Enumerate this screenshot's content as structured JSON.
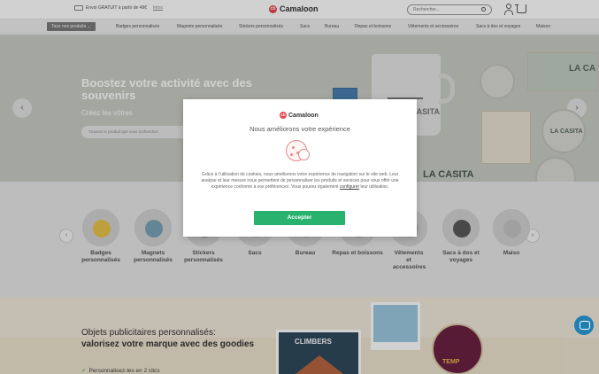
{
  "topbar": {
    "shipping_text": "Envoi GRATUIT à partir de 49€",
    "shipping_more": "Infos",
    "brand": "Camaloon",
    "brand_mark": "cb",
    "search_placeholder": "Rechercher..."
  },
  "catnav": {
    "all_products": "Tous nos produits  ⌄",
    "items": [
      "Badges personnalisés",
      "Magnets personnalisés",
      "Stickers personnalisés",
      "Sacs",
      "Bureau",
      "Repas et boissons",
      "Vêtements et accessoires",
      "Sacs à dos et voyages",
      "Maison"
    ]
  },
  "hero": {
    "title": "Boostez votre activité avec des souvenirs",
    "subtitle": "Créez les vôtres",
    "search_placeholder": "Trouvez le produit que vous recherchez",
    "mug_text": "LA CASITA",
    "sticker_1": "LA CASITA",
    "sticker_2": "LA CASITA",
    "sticker_3": "LA CA",
    "prev_arrow": "‹",
    "next_arrow": "›"
  },
  "categories": [
    {
      "label": "Badges personnalisés",
      "color": "#e9c24a"
    },
    {
      "label": "Magnets personnalisés",
      "color": "#7aa3b8"
    },
    {
      "label": "Stickers personnalisés",
      "color": "#8c9aa6"
    },
    {
      "label": "Sacs",
      "color": "#c9c2b4"
    },
    {
      "label": "Bureau",
      "color": "#b8b8b8"
    },
    {
      "label": "Repas et boissons",
      "color": "#a8a8a8"
    },
    {
      "label": "Vêtements et accessoires",
      "color": "#bdbdbd"
    },
    {
      "label": "Sacs à dos et voyages",
      "color": "#5a5a5a"
    },
    {
      "label": "Maiso",
      "color": "#c4c4c4"
    }
  ],
  "promo": {
    "title_line1": "Objets publicitaires personnalisés:",
    "title_line2": "valorisez votre marque avec des goodies",
    "check_item": "Personnalisez-les en 2 clics",
    "poster_text": "CLIMBERS",
    "badge_text": "TEMP"
  },
  "cookie_modal": {
    "brand": "Camaloon",
    "title": "Nous améliorons votre expérience",
    "body_1": "Grâce à l'utilisation de cookies, nous améliorons votre expérience de navigation sur le site web. Leur analyse et leur mesure nous permettent de personnaliser les produits et services pour vous offrir une expérience conforme à vos préférences. Vous pouvez également",
    "body_link": "configurer",
    "body_2": "leur utilisation.",
    "accept_label": "Accepter"
  },
  "colors": {
    "accent_green": "#29b26e",
    "brand_red": "#e5484d",
    "chat_blue": "#1e7fb0"
  }
}
